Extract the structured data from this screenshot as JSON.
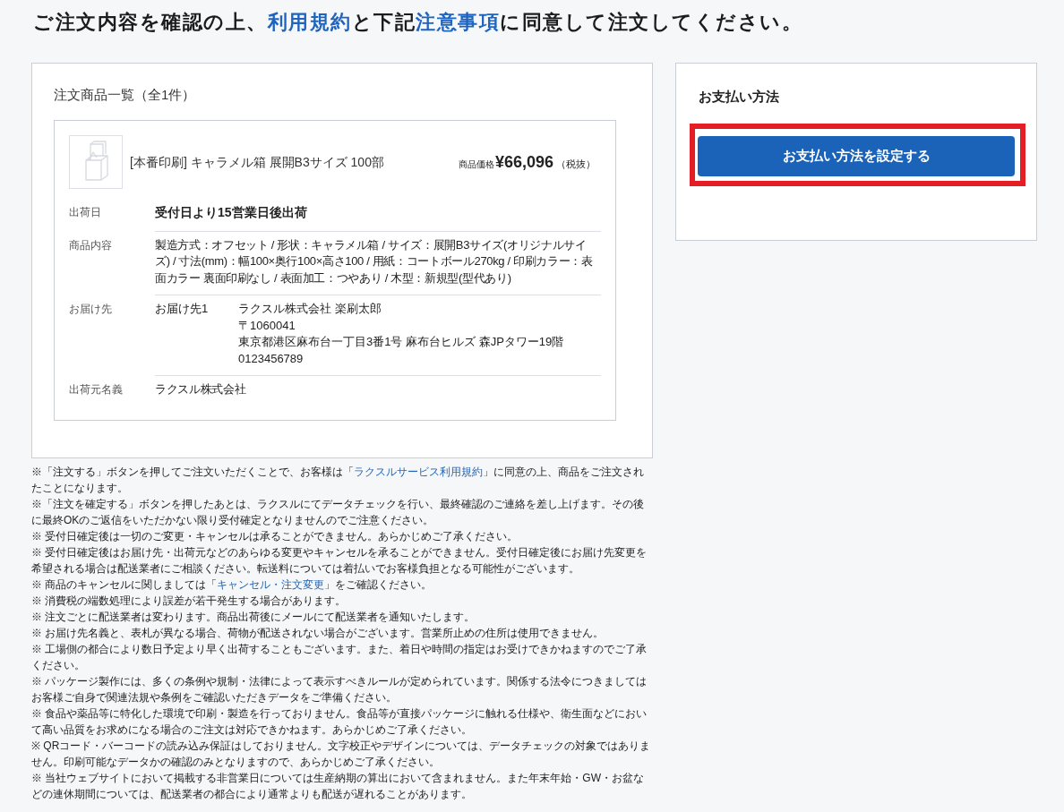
{
  "heading": [
    {
      "text": "ご注文内容を確認の上、",
      "link": false
    },
    {
      "text": "利用規約",
      "link": true
    },
    {
      "text": "と下記",
      "link": false
    },
    {
      "text": "注意事項",
      "link": true
    },
    {
      "text": "に同意して注文してください。",
      "link": false
    }
  ],
  "order_list": {
    "title": "注文商品一覧（全1件）",
    "items": [
      {
        "name": "[本番印刷] キャラメル箱 展開B3サイズ 100部",
        "price_label": "商品価格",
        "price": "¥66,096",
        "tax_note": "（税抜）",
        "details": [
          {
            "kind": "emphasis",
            "label": "出荷日",
            "value": "受付日より15営業日後出荷"
          },
          {
            "kind": "text",
            "label": "商品内容",
            "value": "製造方式：オフセット / 形状：キャラメル箱 / サイズ：展開B3サイズ(オリジナルサイズ) / 寸法(mm)：幅100×奥行100×高さ100 / 用紙：コートボール270kg / 印刷カラー：表面カラー 裏面印刷なし / 表面加工：つやあり / 木型：新規型(型代あり)"
          },
          {
            "kind": "address",
            "label": "お届け先",
            "recipient_label": "お届け先1",
            "lines": [
              "ラクスル株式会社 楽刷太郎",
              "〒1060041",
              "東京都港区麻布台一丁目3番1号 麻布台ヒルズ 森JPタワー19階",
              "0123456789"
            ]
          },
          {
            "kind": "text",
            "label": "出荷元名義",
            "value": "ラクスル株式会社"
          }
        ]
      }
    ]
  },
  "payment": {
    "title": "お支払い方法",
    "button": {
      "label": "お支払い方法を設定する",
      "highlighted": true
    }
  },
  "notes": [
    {
      "parts": [
        {
          "text": "※「注文する」ボタンを押してご注文いただくことで、お客様は「",
          "link": false
        },
        {
          "text": "ラクスルサービス利用規約",
          "link": true
        },
        {
          "text": "」に同意の上、商品をご注文されたことになります。",
          "link": false
        }
      ]
    },
    {
      "parts": [
        {
          "text": "※「注文を確定する」ボタンを押したあとは、ラクスルにてデータチェックを行い、最終確認のご連絡を差し上げます。その後に最終OKのご返信をいただかない限り受付確定となりませんのでご注意ください。",
          "link": false
        }
      ]
    },
    {
      "parts": [
        {
          "text": "※ 受付日確定後は一切のご変更・キャンセルは承ることができません。あらかじめご了承ください。",
          "link": false
        }
      ]
    },
    {
      "parts": [
        {
          "text": "※ 受付日確定後はお届け先・出荷元などのあらゆる変更やキャンセルを承ることができません。受付日確定後にお届け先変更を希望される場合は配送業者にご相談ください。転送料については着払いでお客様負担となる可能性がございます。",
          "link": false
        }
      ]
    },
    {
      "parts": [
        {
          "text": "※ 商品のキャンセルに関しましては「",
          "link": false
        },
        {
          "text": "キャンセル・注文変更",
          "link": true
        },
        {
          "text": "」をご確認ください。",
          "link": false
        }
      ]
    },
    {
      "parts": [
        {
          "text": "※ 消費税の端数処理により誤差が若干発生する場合があります。",
          "link": false
        }
      ]
    },
    {
      "parts": [
        {
          "text": "※ 注文ごとに配送業者は変わります。商品出荷後にメールにて配送業者を通知いたします。",
          "link": false
        }
      ]
    },
    {
      "parts": [
        {
          "text": "※ お届け先名義と、表札が異なる場合、荷物が配送されない場合がございます。営業所止めの住所は使用できません。",
          "link": false
        }
      ]
    },
    {
      "parts": [
        {
          "text": "※ 工場側の都合により数日予定より早く出荷することもございます。また、着日や時間の指定はお受けできかねますのでご了承ください。",
          "link": false
        }
      ]
    },
    {
      "parts": [
        {
          "text": "※ パッケージ製作には、多くの条例や規制・法律によって表示すべきルールが定められています。関係する法令につきましてはお客様ご自身で関連法規や条例をご確認いただきデータをご準備ください。",
          "link": false
        }
      ]
    },
    {
      "parts": [
        {
          "text": "※ 食品や薬品等に特化した環境で印刷・製造を行っておりません。食品等が直接パッケージに触れる仕様や、衛生面などにおいて高い品質をお求めになる場合のご注文は対応できかねます。あらかじめご了承ください。",
          "link": false
        }
      ]
    },
    {
      "parts": [
        {
          "text": "※ QRコード・バーコードの読み込み保証はしておりません。文字校正やデザインについては、データチェックの対象ではありません。印刷可能なデータかの確認のみとなりますので、あらかじめご了承ください。",
          "link": false
        }
      ]
    },
    {
      "parts": [
        {
          "text": "※ 当社ウェブサイトにおいて掲載する非営業日については生産納期の算出において含まれません。また年末年始・GW・お盆などの連休期間については、配送業者の都合により通常よりも配送が遅れることがあります。",
          "link": false
        }
      ]
    }
  ]
}
